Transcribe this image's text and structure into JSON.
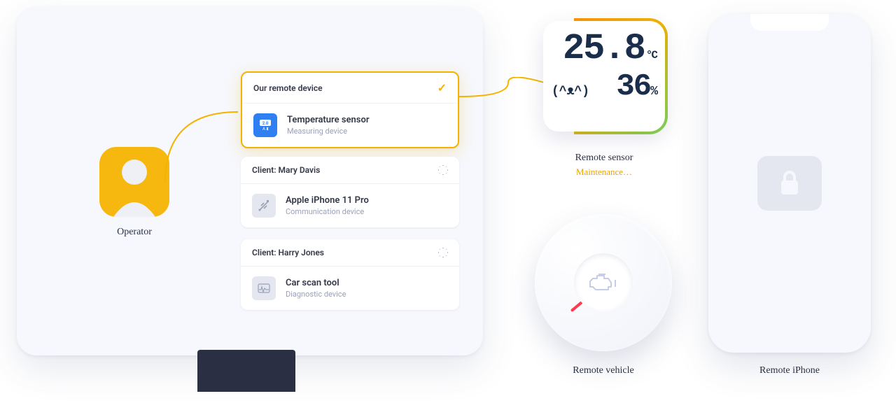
{
  "operator": {
    "label": "Operator"
  },
  "cards": [
    {
      "header": "Our remote device",
      "status": "selected",
      "device_name": "Temperature sensor",
      "device_type": "Measuring device",
      "icon": "sensor-icon"
    },
    {
      "header": "Client: Mary Davis",
      "status": "loading",
      "device_name": "Apple iPhone 11 Pro",
      "device_type": "Communication device",
      "icon": "usb-icon"
    },
    {
      "header": "Client: Harry Jones",
      "status": "loading",
      "device_name": "Car scan tool",
      "device_type": "Diagnostic device",
      "icon": "ecg-icon"
    }
  ],
  "sensor": {
    "temperature": "25.8",
    "temperature_unit": "°C",
    "face": "(^ᴥ^)",
    "humidity": "36",
    "humidity_unit": "%",
    "label": "Remote sensor",
    "status": "Maintenance…"
  },
  "dial": {
    "label": "Remote vehicle"
  },
  "phone": {
    "label": "Remote iPhone"
  }
}
